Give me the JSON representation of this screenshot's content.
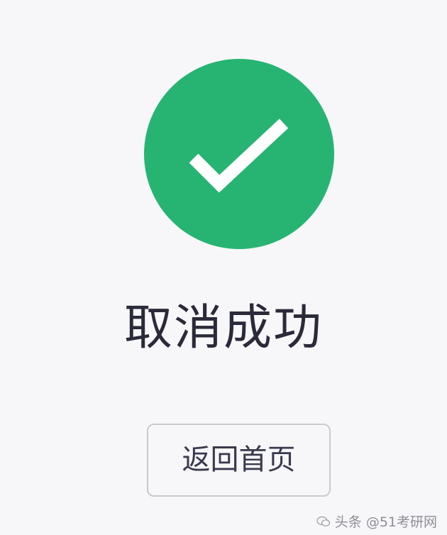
{
  "status": {
    "title": "取消成功",
    "icon": "checkmark-icon",
    "accent_color": "#27b473"
  },
  "actions": {
    "home_label": "返回首页"
  },
  "watermark": {
    "text": "头条 @51考研网",
    "icon": "wechat-icon"
  }
}
